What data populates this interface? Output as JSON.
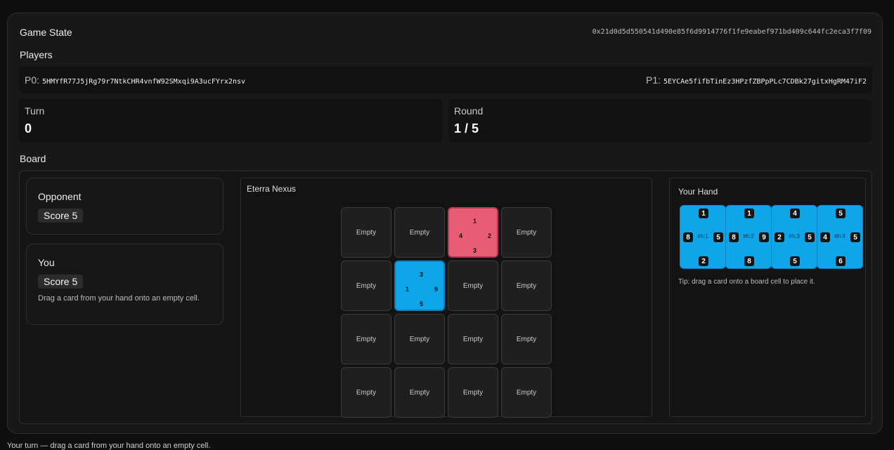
{
  "game_state": {
    "title": "Game State",
    "hash": "0x21d0d5d550541d490e85f6d9914776f1fe9eabef971bd409c644fc2eca3f7f09"
  },
  "players": {
    "title": "Players",
    "p0_label": "P0:",
    "p0_address": "5HMYfR77J5jRg79r7NtkCHR4vnfW92SMxqi9A3ucFYrx2nsv",
    "p1_label": "P1:",
    "p1_address": "5EYCAe5fifbTinEz3HPzfZBPpPLc7CDBk27gitxHgRM47iF2"
  },
  "turn": {
    "label": "Turn",
    "value": "0"
  },
  "round": {
    "label": "Round",
    "value": "1 / 5"
  },
  "board": {
    "title": "Board",
    "opponent": {
      "name": "Opponent",
      "score": "Score 5"
    },
    "you": {
      "name": "You",
      "score": "Score 5",
      "hint": "Drag a card from your hand onto an empty cell."
    },
    "nexus": {
      "title": "Eterra Nexus",
      "empty_label": "Empty",
      "cells": [
        {
          "type": "empty"
        },
        {
          "type": "empty"
        },
        {
          "type": "card",
          "color": "red",
          "top": "1",
          "left": "4",
          "right": "2",
          "bottom": "3"
        },
        {
          "type": "empty"
        },
        {
          "type": "empty"
        },
        {
          "type": "card",
          "color": "blue",
          "top": "3",
          "left": "1",
          "right": "9",
          "bottom": "5"
        },
        {
          "type": "empty"
        },
        {
          "type": "empty"
        },
        {
          "type": "empty"
        },
        {
          "type": "empty"
        },
        {
          "type": "empty"
        },
        {
          "type": "empty"
        },
        {
          "type": "empty"
        },
        {
          "type": "empty"
        },
        {
          "type": "empty"
        },
        {
          "type": "empty"
        }
      ]
    },
    "hand": {
      "title": "Your Hand",
      "tip": "Tip: drag a card onto a board cell to place it.",
      "cards": [
        {
          "id": "#h:1",
          "top": "1",
          "left": "8",
          "right": "5",
          "bottom": "2"
        },
        {
          "id": "#h:2",
          "top": "1",
          "left": "8",
          "right": "9",
          "bottom": "8"
        },
        {
          "id": "#h:3",
          "top": "4",
          "left": "2",
          "right": "5",
          "bottom": "5"
        },
        {
          "id": "#h:4",
          "top": "5",
          "left": "4",
          "right": "5",
          "bottom": "6"
        }
      ]
    }
  },
  "colors": {
    "red_card": "#e85d74",
    "blue_card": "#0ea5e9",
    "panel": "#181818"
  },
  "footer": "Your turn — drag a card from your hand onto an empty cell."
}
